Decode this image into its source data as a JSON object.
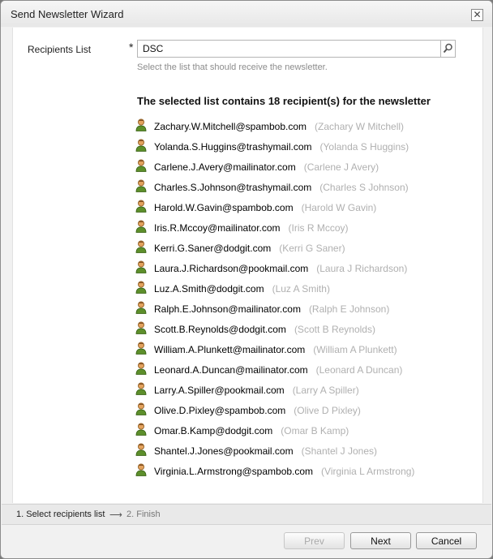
{
  "window": {
    "title": "Send Newsletter Wizard",
    "close_glyph": "✕"
  },
  "form": {
    "recipients_label": "Recipients List",
    "required_marker": "*",
    "list_value": "DSC",
    "hint": "Select the list that should receive the newsletter."
  },
  "summary": "The selected list contains 18 recipient(s) for the newsletter",
  "recipients": [
    {
      "email": "Zachary.W.Mitchell@spambob.com",
      "name": "(Zachary W Mitchell)"
    },
    {
      "email": "Yolanda.S.Huggins@trashymail.com",
      "name": "(Yolanda S Huggins)"
    },
    {
      "email": "Carlene.J.Avery@mailinator.com",
      "name": "(Carlene J Avery)"
    },
    {
      "email": "Charles.S.Johnson@trashymail.com",
      "name": "(Charles S Johnson)"
    },
    {
      "email": "Harold.W.Gavin@spambob.com",
      "name": "(Harold W Gavin)"
    },
    {
      "email": "Iris.R.Mccoy@mailinator.com",
      "name": "(Iris R Mccoy)"
    },
    {
      "email": "Kerri.G.Saner@dodgit.com",
      "name": "(Kerri G Saner)"
    },
    {
      "email": "Laura.J.Richardson@pookmail.com",
      "name": "(Laura J Richardson)"
    },
    {
      "email": "Luz.A.Smith@dodgit.com",
      "name": "(Luz A Smith)"
    },
    {
      "email": "Ralph.E.Johnson@mailinator.com",
      "name": "(Ralph E Johnson)"
    },
    {
      "email": "Scott.B.Reynolds@dodgit.com",
      "name": "(Scott B Reynolds)"
    },
    {
      "email": "William.A.Plunkett@mailinator.com",
      "name": "(William A Plunkett)"
    },
    {
      "email": "Leonard.A.Duncan@mailinator.com",
      "name": "(Leonard A Duncan)"
    },
    {
      "email": "Larry.A.Spiller@pookmail.com",
      "name": "(Larry A Spiller)"
    },
    {
      "email": "Olive.D.Pixley@spambob.com",
      "name": "(Olive D Pixley)"
    },
    {
      "email": "Omar.B.Kamp@dodgit.com",
      "name": "(Omar B Kamp)"
    },
    {
      "email": "Shantel.J.Jones@pookmail.com",
      "name": "(Shantel J Jones)"
    },
    {
      "email": "Virginia.L.Armstrong@spambob.com",
      "name": "(Virginia L Armstrong)"
    }
  ],
  "steps": {
    "step1": "1. Select recipients list",
    "arrow": "⟶",
    "step2": "2. Finish"
  },
  "buttons": {
    "prev": "Prev",
    "next": "Next",
    "cancel": "Cancel"
  },
  "icons": {
    "user": "user-icon",
    "search": "search-icon",
    "close": "close-icon"
  },
  "colors": {
    "accent_name": "#b0b0b0",
    "hint": "#8c8c8c"
  }
}
